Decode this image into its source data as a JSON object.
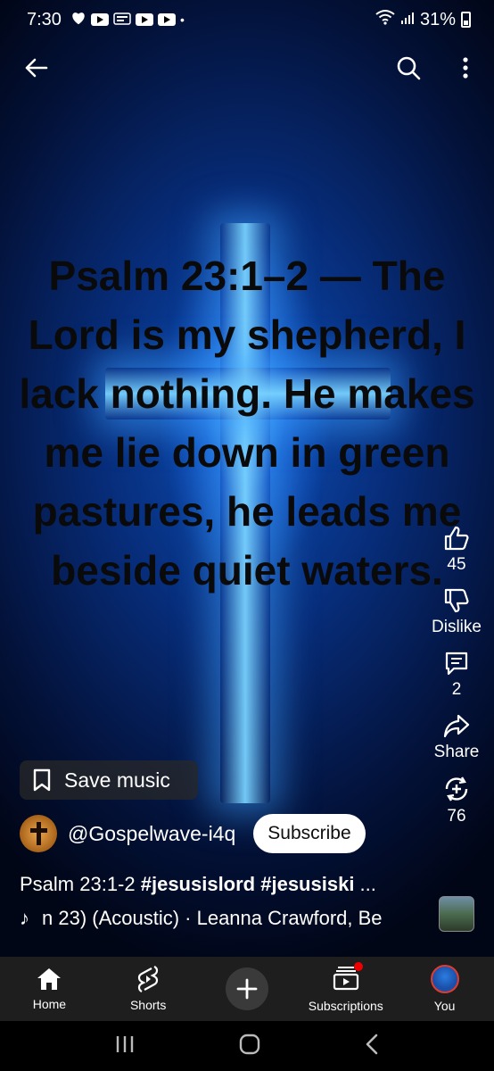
{
  "status_bar": {
    "time": "7:30",
    "battery": "31%"
  },
  "video": {
    "verse_text": "Psalm 23:1–2 — The Lord is my shepherd, I lack nothing. He makes me lie down in green pastures, he leads me beside quiet waters."
  },
  "actions": {
    "like_count": "45",
    "dislike_label": "Dislike",
    "comment_count": "2",
    "share_label": "Share",
    "remix_count": "76"
  },
  "save_music_label": "Save music",
  "channel": {
    "handle": "@Gospelwave-i4q",
    "subscribe_label": "Subscribe"
  },
  "short": {
    "title_plain": "Psalm 23:1-2 ",
    "title_tags": "#jesusislord #jesusiski",
    "title_more": " ..."
  },
  "music": {
    "track_text": "n 23) (Acoustic) · Leanna Crawford, Be"
  },
  "bottom_nav": {
    "home": "Home",
    "shorts": "Shorts",
    "subscriptions": "Subscriptions",
    "you": "You"
  },
  "colors": {
    "accent_red": "#ee0000",
    "nav_bg": "#1e1e1e"
  }
}
